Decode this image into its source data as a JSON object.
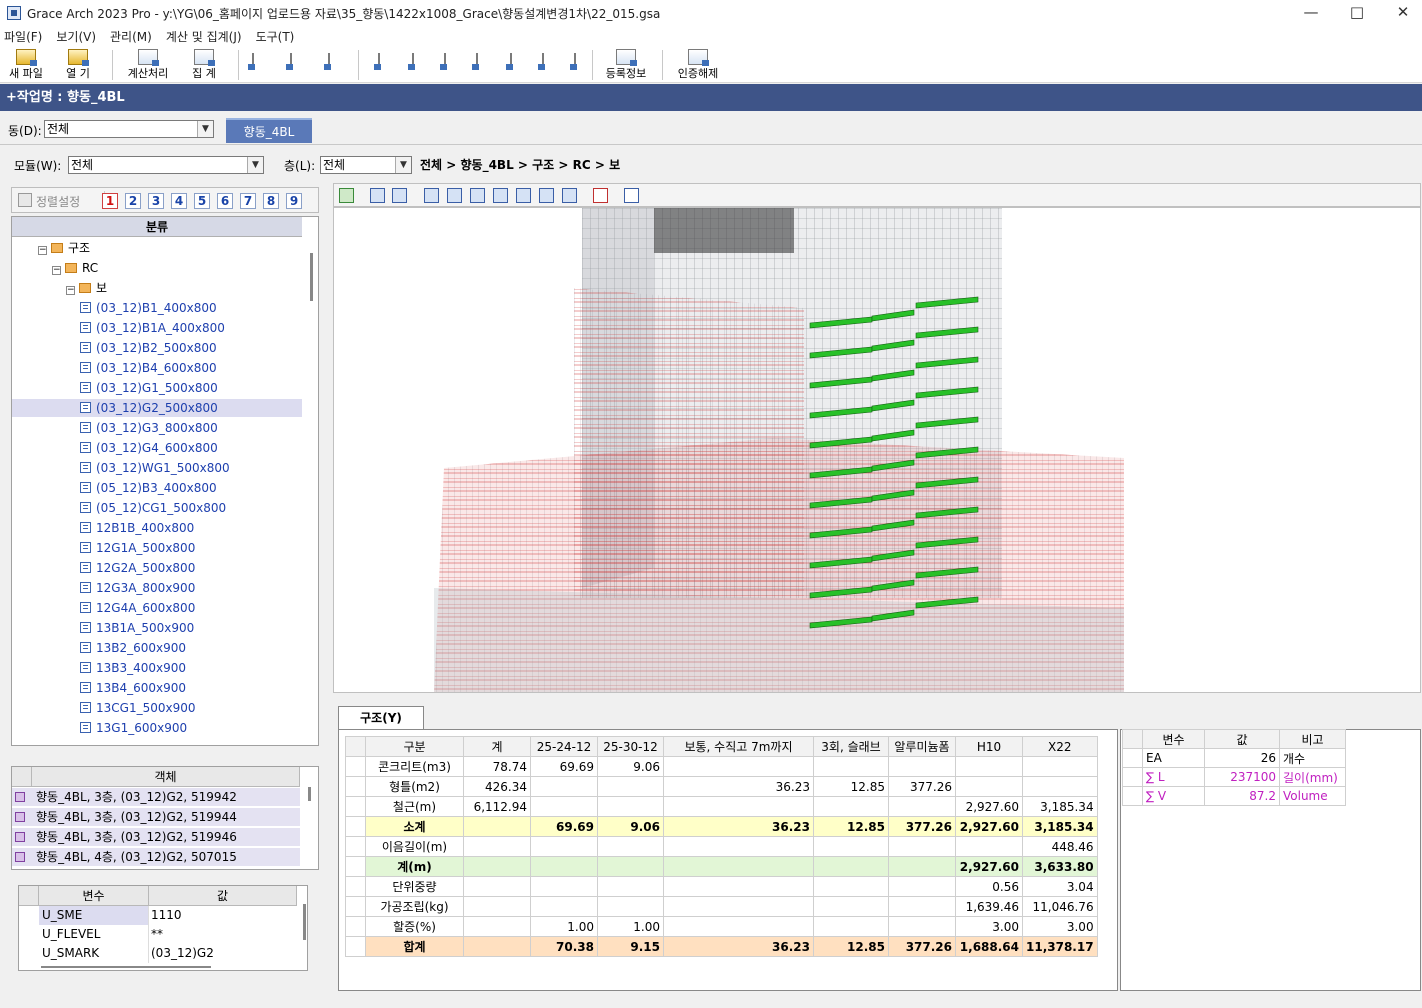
{
  "window": {
    "title": "Grace Arch 2023 Pro - y:\\YG\\06_홈페이지 업로드용 자료\\35_향동\\1422x1008_Grace\\향동설계변경1차\\22_015.gsa"
  },
  "menu": [
    "파일(F)",
    "보기(V)",
    "관리(M)",
    "계산 및 집계(J)",
    "도구(T)"
  ],
  "toolbar": {
    "new_file": "새 파일",
    "open": "열  기",
    "calc": "계산처리",
    "aggregate": "집  계",
    "reg_info": "등록정보",
    "unauth": "인증해제"
  },
  "workbar": {
    "title": "+작업명 : 향동_4BL"
  },
  "filters": {
    "dong_label": "동(D):",
    "dong_value": "전체",
    "dong_tab": "향동_4BL",
    "module_label": "모듈(W):",
    "module_value": "전체",
    "floor_label": "층(L):",
    "floor_value": "전체",
    "breadcrumb": "전체 > 향동_4BL > 구조 > RC > 보"
  },
  "sortbar": {
    "label": "정렬설정",
    "numbers": [
      "1",
      "2",
      "3",
      "4",
      "5",
      "6",
      "7",
      "8",
      "9"
    ]
  },
  "tree": {
    "header": "분류",
    "root": "구조",
    "rc": "RC",
    "beam": "보",
    "items": [
      "(03_12)B1_400x800",
      "(03_12)B1A_400x800",
      "(03_12)B2_500x800",
      "(03_12)B4_600x800",
      "(03_12)G1_500x800",
      "(03_12)G2_500x800",
      "(03_12)G3_800x800",
      "(03_12)G4_600x800",
      "(03_12)WG1_500x800",
      "(05_12)B3_400x800",
      "(05_12)CG1_500x800",
      "12B1B_400x800",
      "12G1A_500x800",
      "12G2A_500x800",
      "12G3A_800x900",
      "12G4A_600x800",
      "13B1A_500x900",
      "13B2_600x900",
      "13B3_400x900",
      "13B4_600x900",
      "13CG1_500x900",
      "13G1_600x900"
    ],
    "selected_index": 5
  },
  "objects": {
    "header": "객체",
    "items": [
      "향동_4BL, 3층, (03_12)G2, 519942",
      "향동_4BL, 3층, (03_12)G2, 519944",
      "향동_4BL, 3층, (03_12)G2, 519946",
      "향동_4BL, 4층, (03_12)G2, 507015"
    ]
  },
  "variables": {
    "col_name": "변수",
    "col_value": "값",
    "rows": [
      {
        "name": "U_SME",
        "value": "1110"
      },
      {
        "name": "U_FLEVEL",
        "value": "**"
      },
      {
        "name": "U_SMARK",
        "value": "(03_12)G2"
      }
    ]
  },
  "bottom_tab": "구조(Y)",
  "qty_table": {
    "headers": [
      "구분",
      "계",
      "25-24-12",
      "25-30-12",
      "보통, 수직고 7m까지",
      "3회, 슬래브",
      "알루미늄폼",
      "H10",
      "X22"
    ],
    "rows": [
      {
        "type": "normal",
        "cells": [
          "콘크리트(m3)",
          "78.74",
          "69.69",
          "9.06",
          "",
          "",
          "",
          "",
          ""
        ]
      },
      {
        "type": "normal",
        "cells": [
          "형틀(m2)",
          "426.34",
          "",
          "",
          "36.23",
          "12.85",
          "377.26",
          "",
          ""
        ]
      },
      {
        "type": "normal",
        "cells": [
          "철근(m)",
          "6,112.94",
          "",
          "",
          "",
          "",
          "",
          "2,927.60",
          "3,185.34"
        ]
      },
      {
        "type": "sub",
        "cells": [
          "소계",
          "",
          "69.69",
          "9.06",
          "36.23",
          "12.85",
          "377.26",
          "2,927.60",
          "3,185.34"
        ]
      },
      {
        "type": "normal",
        "cells": [
          "이음길이(m)",
          "",
          "",
          "",
          "",
          "",
          "",
          "",
          "448.46"
        ]
      },
      {
        "type": "gye",
        "cells": [
          "계(m)",
          "",
          "",
          "",
          "",
          "",
          "",
          "2,927.60",
          "3,633.80"
        ]
      },
      {
        "type": "normal",
        "cells": [
          "단위중량",
          "",
          "",
          "",
          "",
          "",
          "",
          "0.56",
          "3.04"
        ]
      },
      {
        "type": "normal",
        "cells": [
          "가공조립(kg)",
          "",
          "",
          "",
          "",
          "",
          "",
          "1,639.46",
          "11,046.76"
        ]
      },
      {
        "type": "normal",
        "cells": [
          "할증(%)",
          "",
          "1.00",
          "1.00",
          "",
          "",
          "",
          "3.00",
          "3.00"
        ]
      },
      {
        "type": "tot",
        "cells": [
          "합계",
          "",
          "70.38",
          "9.15",
          "36.23",
          "12.85",
          "377.26",
          "1,688.64",
          "11,378.17"
        ]
      }
    ]
  },
  "side_table": {
    "headers": [
      "변수",
      "값",
      "비고"
    ],
    "rows": [
      {
        "name": "EA",
        "value": "26",
        "note": "개수",
        "color": "#000000"
      },
      {
        "name": "∑ L",
        "value": "237100",
        "note": "길이(mm)",
        "color": "#c020c0"
      },
      {
        "name": "∑ V",
        "value": "87.2",
        "note": "Volume",
        "color": "#c020c0"
      }
    ]
  }
}
